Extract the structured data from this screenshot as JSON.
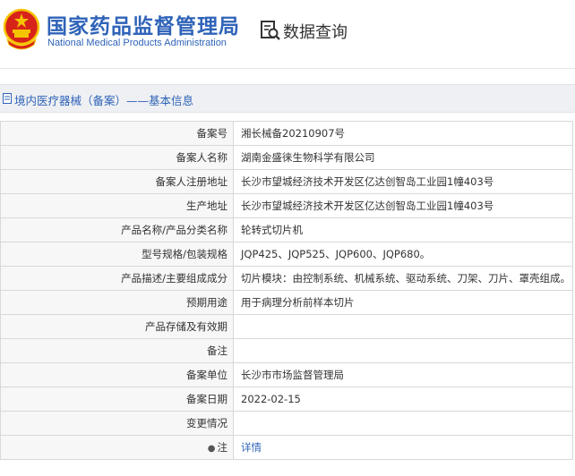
{
  "header": {
    "org_name_cn": "国家药品监督管理局",
    "org_name_en": "National Medical Products Administration",
    "query_title": "数据查询",
    "emblem_icon": "national-emblem",
    "query_icon": "data-query-icon"
  },
  "section": {
    "title": "境内医疗器械（备案）——基本信息",
    "icon": "document-icon"
  },
  "colors": {
    "brand_blue": "#2f63b8",
    "emblem_red": "#d8231a",
    "emblem_gold": "#f5c400"
  },
  "rows": [
    {
      "label": "备案号",
      "value": "湘长械备20210907号"
    },
    {
      "label": "备案人名称",
      "value": "湖南金盛徕生物科学有限公司"
    },
    {
      "label": "备案人注册地址",
      "value": "长沙市望城经济技术开发区亿达创智岛工业园1幢403号"
    },
    {
      "label": "生产地址",
      "value": "长沙市望城经济技术开发区亿达创智岛工业园1幢403号"
    },
    {
      "label": "产品名称/产品分类名称",
      "value": "轮转式切片机"
    },
    {
      "label": "型号规格/包装规格",
      "value": "JQP425、JQP525、JQP600、JQP680。"
    },
    {
      "label": "产品描述/主要组成成分",
      "value": "切片模块：由控制系统、机械系统、驱动系统、刀架、刀片、罩壳组成。"
    },
    {
      "label": "预期用途",
      "value": "用于病理分析前样本切片"
    },
    {
      "label": "产品存储及有效期",
      "value": ""
    },
    {
      "label": "备注",
      "value": ""
    },
    {
      "label": "备案单位",
      "value": "长沙市市场监督管理局"
    },
    {
      "label": "备案日期",
      "value": "2022-02-15"
    },
    {
      "label": "变更情况",
      "value": ""
    }
  ],
  "note_row": {
    "label": "注",
    "link": "详情",
    "icon": "pin-icon"
  }
}
